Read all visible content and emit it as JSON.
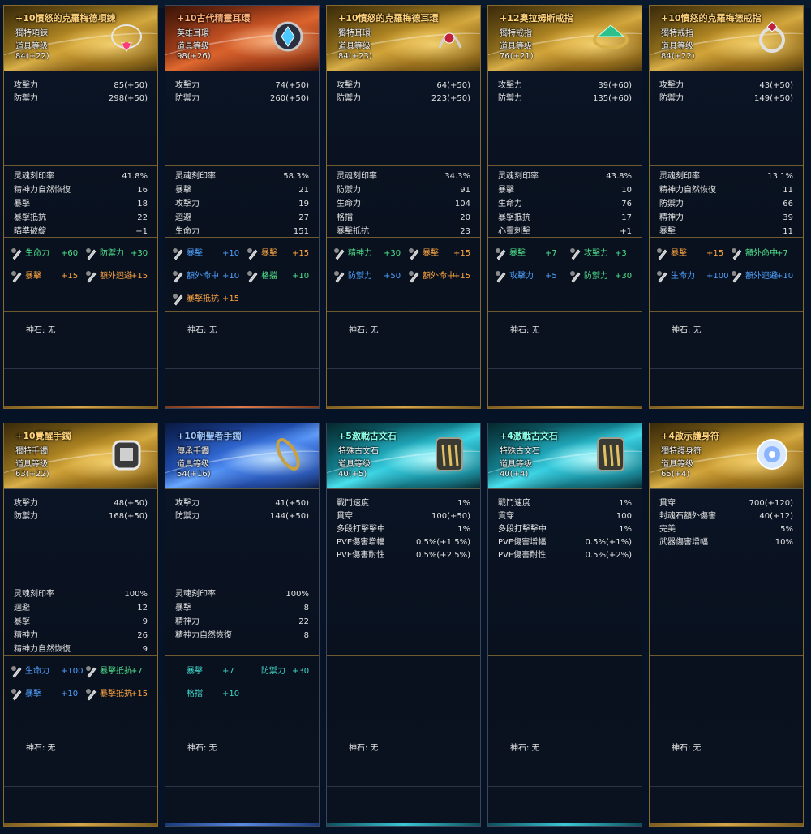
{
  "gem_label": "神石: 无",
  "cards": [
    {
      "title": "+10憤怒的克羅梅德項鍊",
      "type": "獨特項鍊",
      "level_label": "道具等级",
      "level": "84(+22)",
      "base": [
        [
          "攻擊力",
          "85(+50)"
        ],
        [
          "防禦力",
          "298(+50)"
        ]
      ],
      "ext": [
        [
          "灵魂刻印率",
          "41.8%"
        ],
        [
          "精神力自然恢復",
          "16"
        ],
        [
          "暴擊",
          "18"
        ],
        [
          "暴擊抵抗",
          "22"
        ],
        [
          "瞄準破綻",
          "+1"
        ]
      ],
      "opts": [
        [
          "生命力",
          "+60",
          "green"
        ],
        [
          "防禦力",
          "+30",
          "green"
        ],
        [
          "暴擊",
          "+15",
          "orange-t"
        ],
        [
          "額外迴避",
          "+15",
          "orange-t"
        ]
      ]
    },
    {
      "title": "+10古代精靈耳環",
      "type": "英雄耳環",
      "level_label": "道具等级",
      "level": "98(+26)",
      "base": [
        [
          "攻擊力",
          "74(+50)"
        ],
        [
          "防禦力",
          "260(+50)"
        ]
      ],
      "ext": [
        [
          "灵魂刻印率",
          "58.3%"
        ],
        [
          "暴擊",
          "21"
        ],
        [
          "攻擊力",
          "19"
        ],
        [
          "迴避",
          "27"
        ],
        [
          "生命力",
          "151"
        ]
      ],
      "opts": [
        [
          "暴擊",
          "+10",
          "blue-t"
        ],
        [
          "暴擊",
          "+15",
          "orange-t"
        ],
        [
          "額外命中",
          "+10",
          "blue-t"
        ],
        [
          "格擋",
          "+10",
          "green"
        ],
        [
          "暴擊抵抗",
          "+15",
          "orange-t"
        ]
      ]
    },
    {
      "title": "+10憤怒的克羅梅德耳環",
      "type": "獨特耳環",
      "level_label": "道具等级",
      "level": "84(+23)",
      "base": [
        [
          "攻擊力",
          "64(+50)"
        ],
        [
          "防禦力",
          "223(+50)"
        ]
      ],
      "ext": [
        [
          "灵魂刻印率",
          "34.3%"
        ],
        [
          "防禦力",
          "91"
        ],
        [
          "生命力",
          "104"
        ],
        [
          "格擋",
          "20"
        ],
        [
          "暴擊抵抗",
          "23"
        ]
      ],
      "opts": [
        [
          "精神力",
          "+30",
          "green"
        ],
        [
          "暴擊",
          "+15",
          "orange-t"
        ],
        [
          "防禦力",
          "+50",
          "blue-t"
        ],
        [
          "額外命中",
          "+15",
          "orange-t"
        ]
      ]
    },
    {
      "title": "+12奧拉姆斯戒指",
      "type": "獨特戒指",
      "level_label": "道具等级",
      "level": "76(+21)",
      "base": [
        [
          "攻擊力",
          "39(+60)"
        ],
        [
          "防禦力",
          "135(+60)"
        ]
      ],
      "ext": [
        [
          "灵魂刻印率",
          "43.8%"
        ],
        [
          "暴擊",
          "10"
        ],
        [
          "生命力",
          "76"
        ],
        [
          "暴擊抵抗",
          "17"
        ],
        [
          "心靈刺擊",
          "+1"
        ]
      ],
      "opts": [
        [
          "暴擊",
          "+7",
          "green"
        ],
        [
          "攻擊力",
          "+3",
          "green"
        ],
        [
          "攻擊力",
          "+5",
          "blue-t"
        ],
        [
          "防禦力",
          "+30",
          "green"
        ]
      ]
    },
    {
      "title": "+10憤怒的克羅梅德戒指",
      "type": "獨特戒指",
      "level_label": "道具等级",
      "level": "84(+22)",
      "base": [
        [
          "攻擊力",
          "43(+50)"
        ],
        [
          "防禦力",
          "149(+50)"
        ]
      ],
      "ext": [
        [
          "灵魂刻印率",
          "13.1%"
        ],
        [
          "精神力自然恢復",
          "11"
        ],
        [
          "防禦力",
          "66"
        ],
        [
          "精神力",
          "39"
        ],
        [
          "暴擊",
          "11"
        ]
      ],
      "opts": [
        [
          "暴擊",
          "+15",
          "orange-t"
        ],
        [
          "額外命中",
          "+7",
          "green"
        ],
        [
          "生命力",
          "+100",
          "blue-t"
        ],
        [
          "額外迴避",
          "+10",
          "blue-t"
        ]
      ]
    },
    {
      "title": "+10覺醒手鐲",
      "type": "獨特手鐲",
      "level_label": "道具等级",
      "level": "63(+22)",
      "base": [
        [
          "攻擊力",
          "48(+50)"
        ],
        [
          "防禦力",
          "168(+50)"
        ]
      ],
      "ext": [
        [
          "灵魂刻印率",
          "100%"
        ],
        [
          "迴避",
          "12"
        ],
        [
          "暴擊",
          "9"
        ],
        [
          "精神力",
          "26"
        ],
        [
          "精神力自然恢復",
          "9"
        ]
      ],
      "opts": [
        [
          "生命力",
          "+100",
          "blue-t"
        ],
        [
          "暴擊抵抗",
          "+7",
          "green"
        ],
        [
          "暴擊",
          "+10",
          "blue-t"
        ],
        [
          "暴擊抵抗",
          "+15",
          "orange-t"
        ]
      ]
    },
    {
      "title": "+10朝聖者手鐲",
      "type": "傳承手鐲",
      "level_label": "道具等级",
      "level": "54(+16)",
      "base": [
        [
          "攻擊力",
          "41(+50)"
        ],
        [
          "防禦力",
          "144(+50)"
        ]
      ],
      "ext": [
        [
          "灵魂刻印率",
          "100%"
        ],
        [
          "暴擊",
          "8"
        ],
        [
          "精神力",
          "22"
        ],
        [
          "精神力自然恢復",
          "8"
        ]
      ],
      "opts": [
        [
          "暴擊",
          "+7",
          "teal-t"
        ],
        [
          "防禦力",
          "+30",
          "teal-t"
        ],
        [
          "格擋",
          "+10",
          "teal-t"
        ]
      ]
    },
    {
      "title": "+5激戰古文石",
      "type": "特殊古文石",
      "level_label": "道具等级",
      "level": "40(+5)",
      "base": [
        [
          "戰鬥速度",
          "1%"
        ],
        [
          "貫穿",
          "100(+50)"
        ],
        [
          "多段打擊擊中",
          "1%"
        ],
        [
          "PVE傷害增幅",
          "0.5%(+1.5%)"
        ],
        [
          "PVE傷害耐性",
          "0.5%(+2.5%)"
        ]
      ],
      "ext": [],
      "opts": []
    },
    {
      "title": "+4激戰古文石",
      "type": "特殊古文石",
      "level_label": "道具等级",
      "level": "40(+4)",
      "base": [
        [
          "戰鬥速度",
          "1%"
        ],
        [
          "貫穿",
          "100"
        ],
        [
          "多段打擊擊中",
          "1%"
        ],
        [
          "PVE傷害增幅",
          "0.5%(+1%)"
        ],
        [
          "PVE傷害耐性",
          "0.5%(+2%)"
        ]
      ],
      "ext": [],
      "opts": []
    },
    {
      "title": "+4啟示護身符",
      "type": "獨特護身符",
      "level_label": "道具等级",
      "level": "65(+4)",
      "base": [
        [
          "貫穿",
          "700(+120)"
        ],
        [
          "封魂石額外傷害",
          "40(+12)"
        ],
        [
          "完美",
          "5%"
        ],
        [
          "武器傷害增幅",
          "10%"
        ]
      ],
      "ext": [],
      "opts": []
    }
  ]
}
